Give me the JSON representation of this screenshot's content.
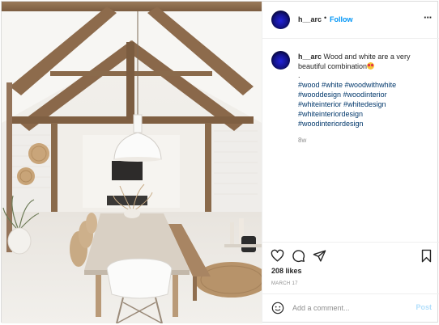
{
  "post": {
    "username": "h__arc",
    "separator": "•",
    "follow_label": "Follow",
    "more_label": "···",
    "caption": "Wood and white are a very beautiful combination",
    "caption_period": ".",
    "hashtags_line1": "#wood #white #woodwithwhite",
    "hashtags_line2": "#wooddesign #woodinterior",
    "hashtags_line3": "#whiteinterior #whitedesign",
    "hashtags_line4": "#whiteinteriordesign",
    "hashtags_line5": "#woodinteriordesign",
    "age": "8w",
    "likes": "208 likes",
    "date": "MARCH 17",
    "comment_placeholder": "Add a comment...",
    "post_label": "Post"
  },
  "icons": {
    "avatar": "avatar",
    "emoji": "heart-eyes-emoji-icon",
    "like": "heart-icon",
    "comment": "comment-icon",
    "share": "share-icon",
    "save": "bookmark-icon",
    "smile": "smiley-icon"
  },
  "colors": {
    "link_blue": "#0095f6",
    "hashtag": "#00376b",
    "muted": "#8e8e8e",
    "post_disabled": "#b2dffc"
  }
}
